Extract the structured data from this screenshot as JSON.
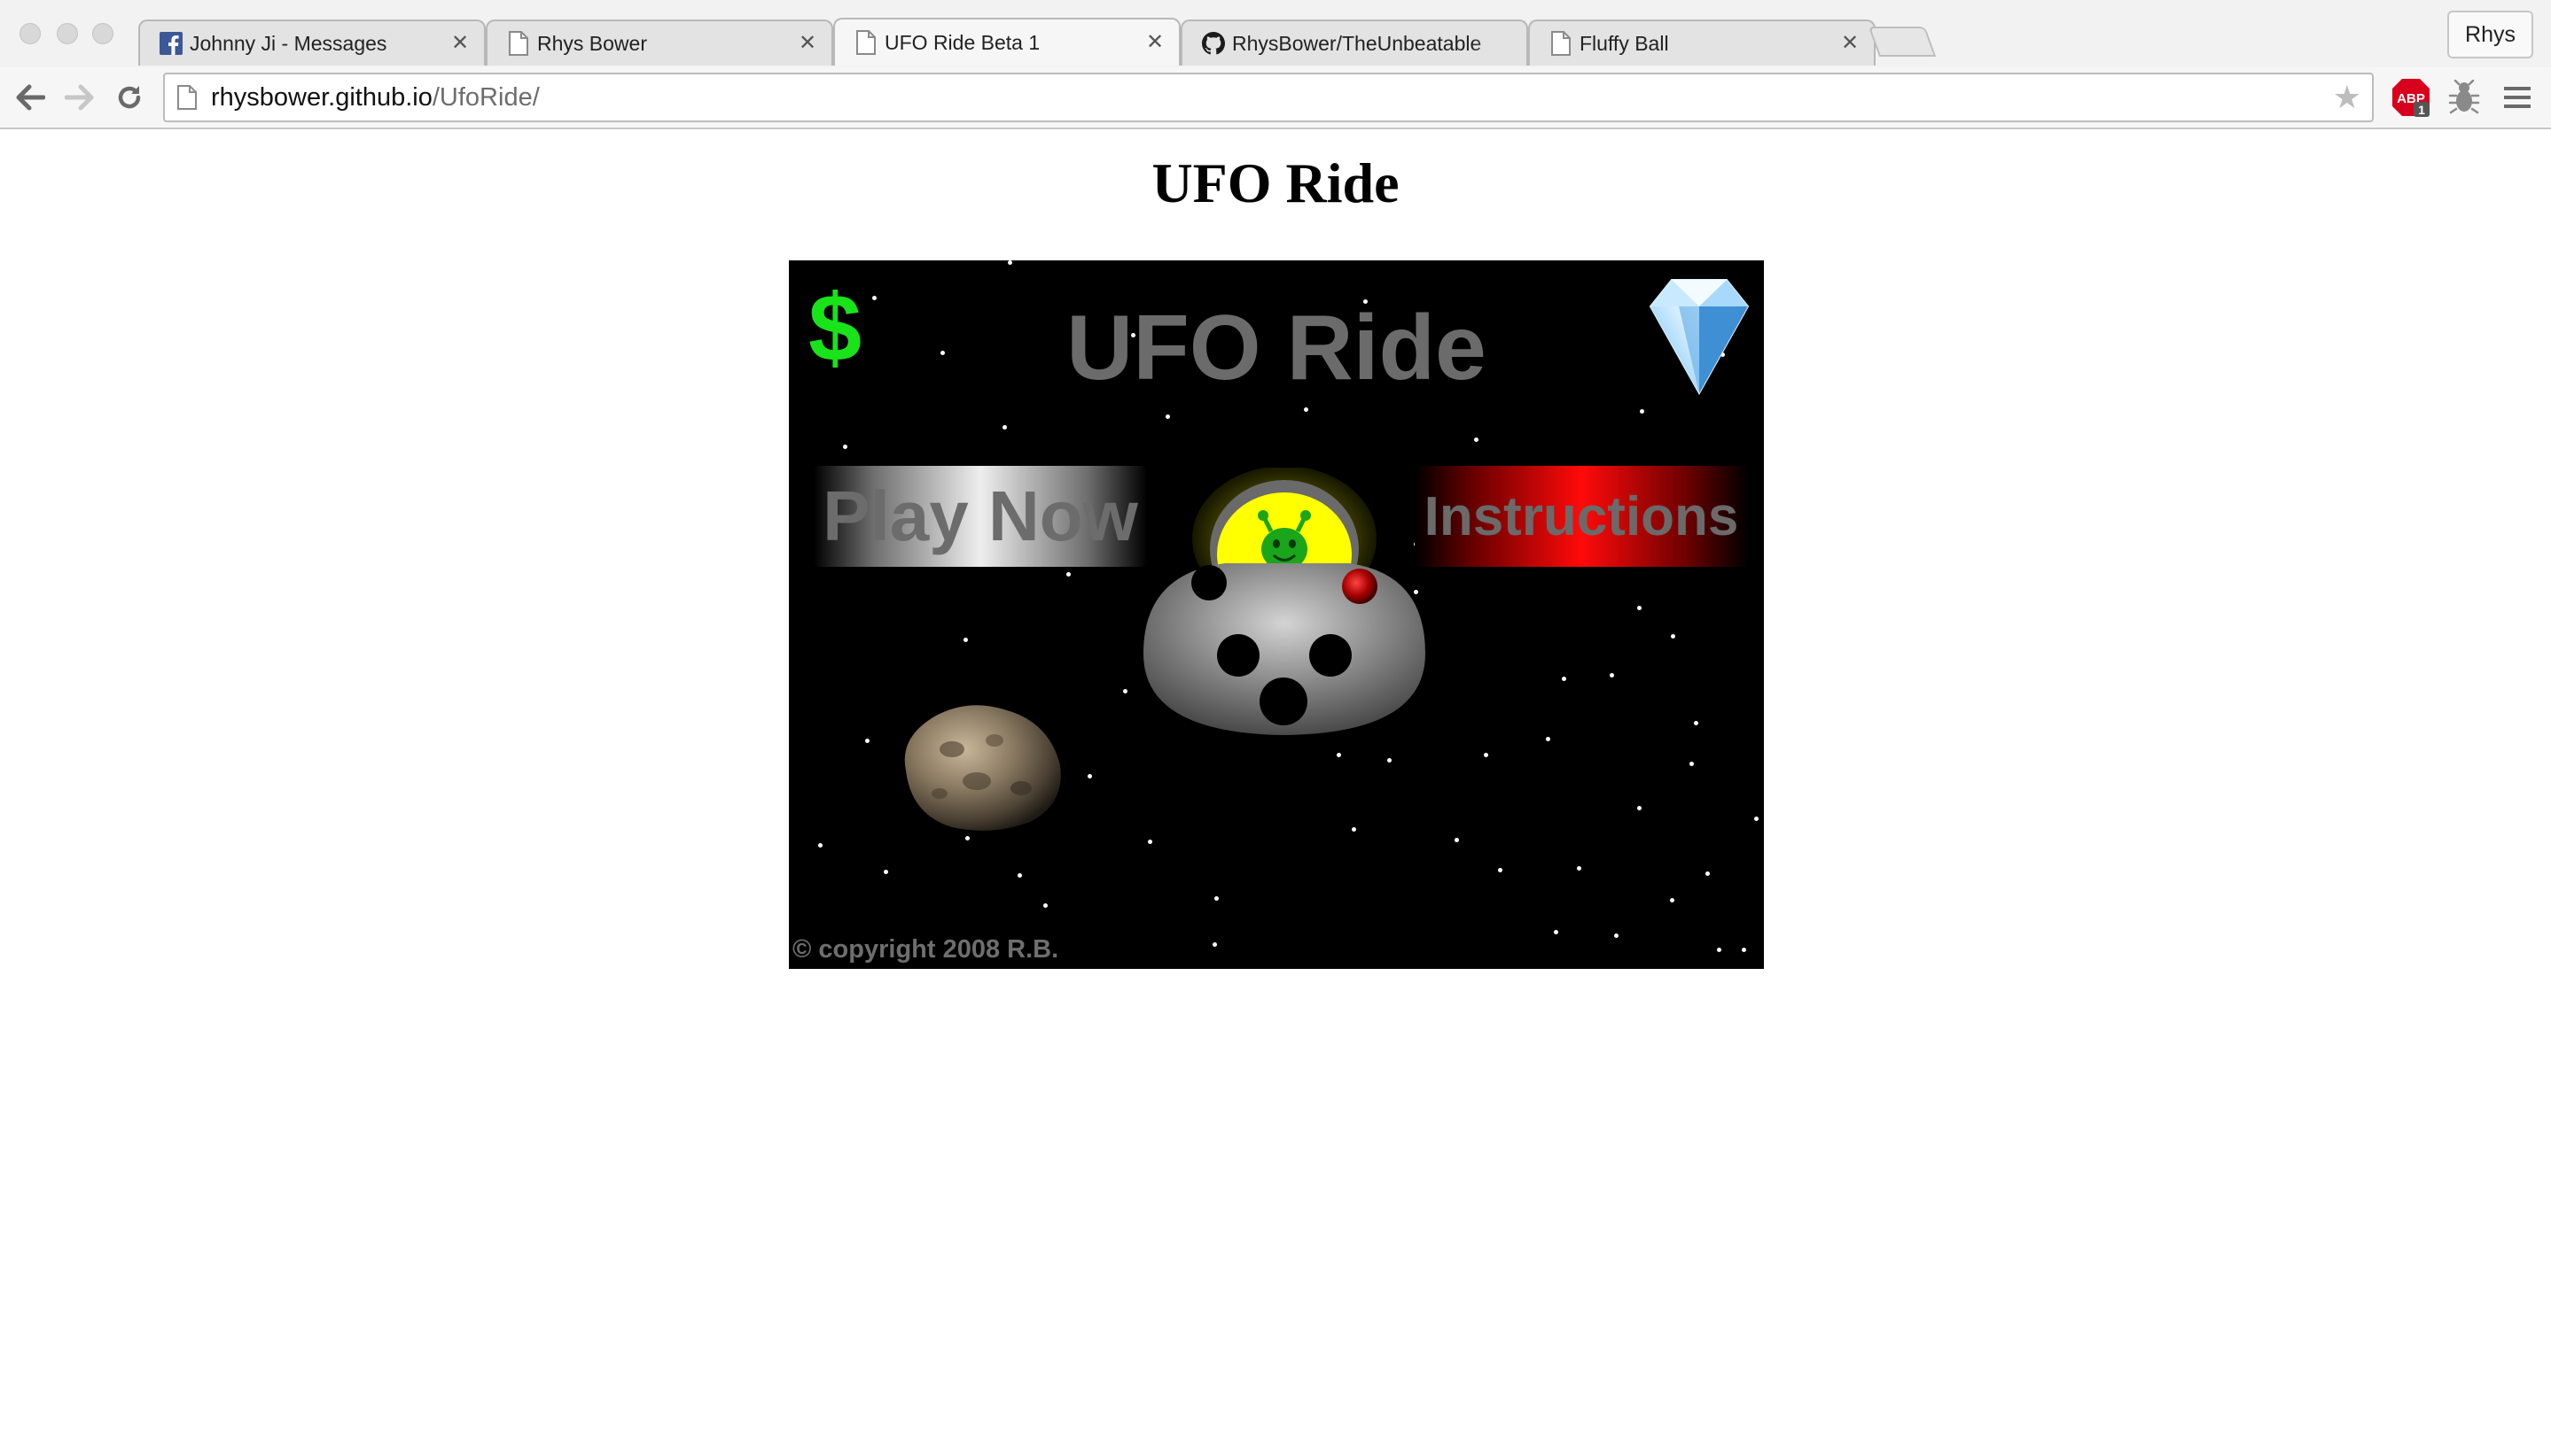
{
  "browser": {
    "tabs": [
      {
        "title": "Johnny Ji - Messages",
        "favicon": "facebook-icon",
        "active": false
      },
      {
        "title": "Rhys Bower",
        "favicon": "page-icon",
        "active": false
      },
      {
        "title": "UFO Ride Beta 1",
        "favicon": "page-icon",
        "active": true
      },
      {
        "title": "RhysBower/TheUnbeatable",
        "favicon": "github-icon",
        "active": false
      },
      {
        "title": "Fluffy Ball",
        "favicon": "page-icon",
        "active": false
      }
    ],
    "profile_label": "Rhys",
    "url_host": "rhysbower.github.io",
    "url_path": "/UfoRide/",
    "extensions": [
      {
        "name": "adblock-plus-icon",
        "label": "ABP",
        "badge": "1",
        "color": "#d8001c"
      },
      {
        "name": "bug-icon"
      },
      {
        "name": "menu-icon"
      }
    ]
  },
  "page": {
    "heading": "UFO Ride"
  },
  "game": {
    "title": "UFO Ride",
    "currency_symbol": "$",
    "play_label": "Play Now",
    "instructions_label": "Instructions",
    "copyright": "© copyright 2008 R.B.",
    "icons": [
      "dollar-icon",
      "diamond-icon",
      "ufo-icon",
      "alien-icon",
      "asteroid-icon"
    ],
    "colors": {
      "background": "#000000",
      "title_text": "#6b6b6b",
      "dollar": "#19e319",
      "instructions_button": "#ff0a0a",
      "play_button": "#eeeeee",
      "alien": "#1aa51a",
      "cockpit": "#ffff00"
    }
  }
}
